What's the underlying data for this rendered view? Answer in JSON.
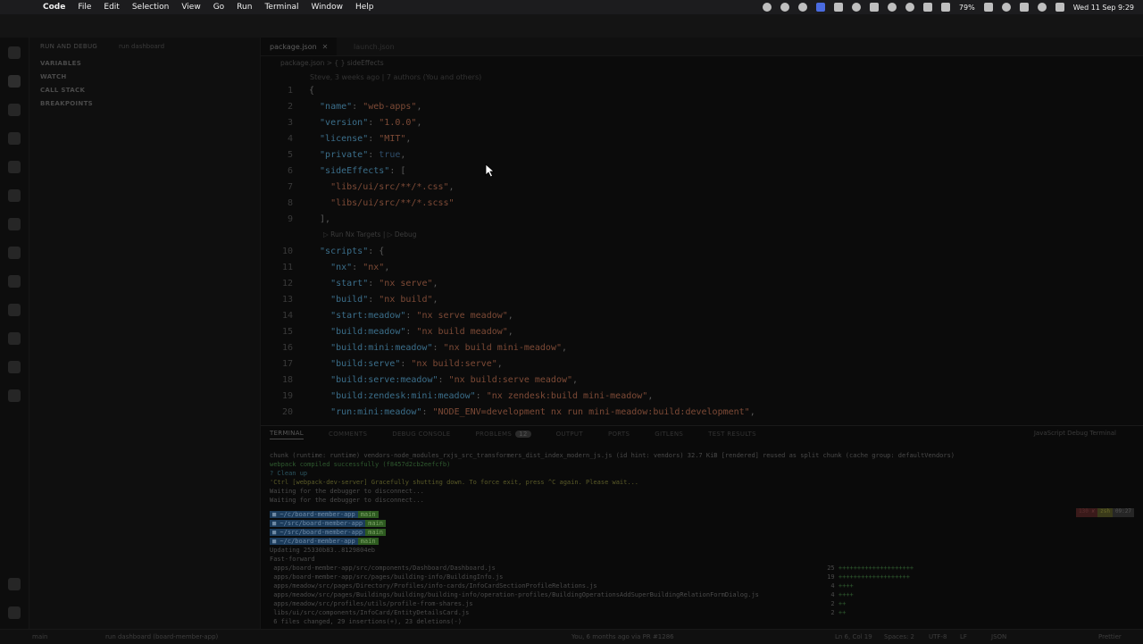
{
  "menubar": {
    "app": "Code",
    "items": [
      "File",
      "Edit",
      "Selection",
      "View",
      "Go",
      "Run",
      "Terminal",
      "Window",
      "Help"
    ],
    "battery": "79%",
    "datetime": "Wed 11 Sep 9:29"
  },
  "sidebar": {
    "title": "RUN AND DEBUG",
    "config": "run dashboard",
    "sections": [
      "VARIABLES",
      "WATCH",
      "CALL STACK",
      "BREAKPOINTS"
    ]
  },
  "tabs": [
    {
      "label": "package.json",
      "close": "✕"
    },
    {
      "label": "launch.json"
    }
  ],
  "breadcrumb": "package.json > { } sideEffects",
  "blame": "Steve, 3 weeks ago | 7 authors (You and others)",
  "codelens": "▷ Run Nx Targets | ▷ Debug",
  "editor": {
    "lines": [
      {
        "n": "1",
        "parts": [
          [
            "p",
            "{"
          ]
        ]
      },
      {
        "n": "2",
        "parts": [
          [
            "k",
            "  \"name\""
          ],
          [
            "p",
            ": "
          ],
          [
            "s",
            "\"web-apps\""
          ],
          [
            "p",
            ","
          ]
        ]
      },
      {
        "n": "3",
        "parts": [
          [
            "k",
            "  \"version\""
          ],
          [
            "p",
            ": "
          ],
          [
            "s",
            "\"1.0.0\""
          ],
          [
            "p",
            ","
          ]
        ]
      },
      {
        "n": "4",
        "parts": [
          [
            "k",
            "  \"license\""
          ],
          [
            "p",
            ": "
          ],
          [
            "s",
            "\"MIT\""
          ],
          [
            "p",
            ","
          ]
        ]
      },
      {
        "n": "5",
        "parts": [
          [
            "k",
            "  \"private\""
          ],
          [
            "p",
            ": "
          ],
          [
            "b",
            "true"
          ],
          [
            "p",
            ","
          ]
        ]
      },
      {
        "n": "6",
        "parts": [
          [
            "k",
            "  \"sideEffects\""
          ],
          [
            "p",
            ": ["
          ]
        ]
      },
      {
        "n": "7",
        "parts": [
          [
            "s",
            "    \"libs/ui/src/**/*.css\""
          ],
          [
            "p",
            ","
          ]
        ]
      },
      {
        "n": "8",
        "parts": [
          [
            "s",
            "    \"libs/ui/src/**/*.scss\""
          ]
        ]
      },
      {
        "n": "9",
        "parts": [
          [
            "p",
            "  ],"
          ]
        ]
      },
      {
        "n": "10",
        "parts": [
          [
            "k",
            "  \"scripts\""
          ],
          [
            "p",
            ": {"
          ]
        ]
      },
      {
        "n": "11",
        "parts": [
          [
            "k",
            "    \"nx\""
          ],
          [
            "p",
            ": "
          ],
          [
            "s",
            "\"nx\""
          ],
          [
            "p",
            ","
          ]
        ]
      },
      {
        "n": "12",
        "parts": [
          [
            "k",
            "    \"start\""
          ],
          [
            "p",
            ": "
          ],
          [
            "s",
            "\"nx serve\""
          ],
          [
            "p",
            ","
          ]
        ]
      },
      {
        "n": "13",
        "parts": [
          [
            "k",
            "    \"build\""
          ],
          [
            "p",
            ": "
          ],
          [
            "s",
            "\"nx build\""
          ],
          [
            "p",
            ","
          ]
        ]
      },
      {
        "n": "14",
        "parts": [
          [
            "k",
            "    \"start:meadow\""
          ],
          [
            "p",
            ": "
          ],
          [
            "s",
            "\"nx serve meadow\""
          ],
          [
            "p",
            ","
          ]
        ]
      },
      {
        "n": "15",
        "parts": [
          [
            "k",
            "    \"build:meadow\""
          ],
          [
            "p",
            ": "
          ],
          [
            "s",
            "\"nx build meadow\""
          ],
          [
            "p",
            ","
          ]
        ]
      },
      {
        "n": "16",
        "parts": [
          [
            "k",
            "    \"build:mini:meadow\""
          ],
          [
            "p",
            ": "
          ],
          [
            "s",
            "\"nx build mini-meadow\""
          ],
          [
            "p",
            ","
          ]
        ]
      },
      {
        "n": "17",
        "parts": [
          [
            "k",
            "    \"build:serve\""
          ],
          [
            "p",
            ": "
          ],
          [
            "s",
            "\"nx build:serve\""
          ],
          [
            "p",
            ","
          ]
        ]
      },
      {
        "n": "18",
        "parts": [
          [
            "k",
            "    \"build:serve:meadow\""
          ],
          [
            "p",
            ": "
          ],
          [
            "s",
            "\"nx build:serve meadow\""
          ],
          [
            "p",
            ","
          ]
        ]
      },
      {
        "n": "19",
        "parts": [
          [
            "k",
            "    \"build:zendesk:mini:meadow\""
          ],
          [
            "p",
            ": "
          ],
          [
            "s",
            "\"nx zendesk:build mini-meadow\""
          ],
          [
            "p",
            ","
          ]
        ]
      },
      {
        "n": "20",
        "parts": [
          [
            "k",
            "    \"run:mini:meadow\""
          ],
          [
            "p",
            ": "
          ],
          [
            "s",
            "\"NODE_ENV=development nx run mini-meadow:build:development\""
          ],
          [
            "p",
            ","
          ]
        ]
      }
    ]
  },
  "panel": {
    "tabs": [
      "TERMINAL",
      "COMMENTS",
      "DEBUG CONSOLE",
      "PROBLEMS",
      "OUTPUT",
      "PORTS",
      "GITLENS",
      "TEST RESULTS"
    ],
    "problems_count": "12",
    "active_terminal": "JavaScript Debug Terminal",
    "lines": [
      {
        "c": "",
        "t": "chunk (runtime: runtime) vendors-node_modules_rxjs_src_transformers_dist_index_modern_js.js (id hint: vendors) 32.7 KiB [rendered] reused as split chunk (cache group: defaultVendors)"
      },
      {
        "c": "tg",
        "t": "webpack compiled successfully (f8457d2cb2eefcfb)"
      },
      {
        "c": "tc",
        "t": "? Clean up"
      },
      {
        "c": "ty",
        "t": "'Ctrl [webpack-dev-server] Gracefully shutting down. To force exit, press ^C again. Please wait..."
      },
      {
        "c": "",
        "t": "Waiting for the debugger to disconnect..."
      },
      {
        "c": "",
        "t": "Waiting for the debugger to disconnect..."
      }
    ],
    "prompts": [
      "~/c/board-member-app",
      "~/src/board-member-app",
      "~/src/board-member-app",
      "~/c/board-member-app"
    ],
    "git": [
      "Updating 25330b83..8129804eb",
      "Fast-forward",
      " apps/board-member-app/src/components/Dashboard/Dashboard.js",
      " apps/board-member-app/src/pages/building-info/BuildingInfo.js",
      " apps/meadow/src/pages/Directory/Profiles/info-cards/InfoCardSectionProfileRelations.js",
      " apps/meadow/src/pages/Buildings/building/building-info/operation-profiles/BuildingOperationsAddSuperBuildingRelationFormDialog.js",
      " apps/meadow/src/profiles/utils/profile-from-shares.js",
      " libs/ui/src/components/InfoCard/EntityDetailsCard.js",
      " 6 files changed, 29 insertions(+), 23 deletions(-)"
    ],
    "stats": [
      "25",
      "19",
      "4",
      "4",
      "2",
      "2"
    ]
  },
  "statusbar": {
    "branch": "main",
    "debug": "run dashboard (board-member-app)",
    "blame": "You, 6 months ago via PR #1286",
    "cursor": "Ln 6, Col 19",
    "spaces": "Spaces: 2",
    "encoding": "UTF-8",
    "eol": "LF",
    "lang": "JSON",
    "prettier": "Prettier"
  }
}
